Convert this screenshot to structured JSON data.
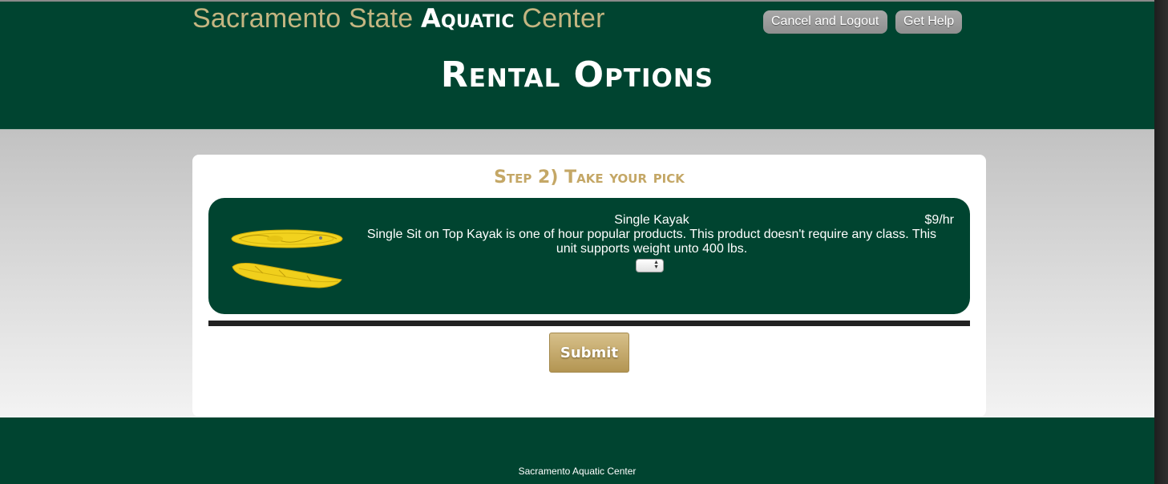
{
  "header": {
    "site_title_prefix": "Sacramento State ",
    "site_title_strong": "Aquatic",
    "site_title_suffix": " Center",
    "logout_label": "Cancel and Logout",
    "help_label": "Get Help",
    "page_title": "Rental Options"
  },
  "step": {
    "title": "Step 2) Take your pick"
  },
  "product": {
    "name": "Single Kayak",
    "price": "$9/hr",
    "description": "Single Sit on Top Kayak is one of hour popular products. This product doesn't require any class. This unit supports weight unto 400 lbs.",
    "image_icon": "kayak-image",
    "quantity_value": ""
  },
  "form": {
    "submit_label": "Submit"
  },
  "footer": {
    "text": "Sacramento Aquatic Center"
  },
  "colors": {
    "brand_green": "#004430",
    "gold": "#c4b581",
    "button_gold": "#c4a766"
  }
}
